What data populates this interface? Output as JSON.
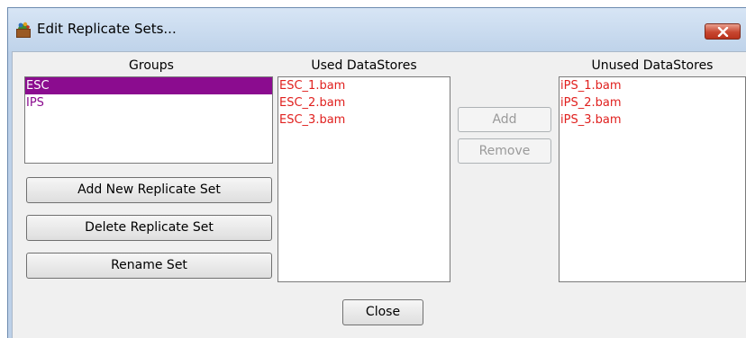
{
  "window": {
    "title": "Edit Replicate Sets...",
    "close_icon": "close-x-icon",
    "accent_close": "#c84730"
  },
  "groups": {
    "label": "Groups",
    "items": [
      {
        "label": "ESC",
        "selected": true
      },
      {
        "label": "IPS",
        "selected": false
      }
    ],
    "selected_color": "#8b0c8f"
  },
  "used": {
    "label": "Used DataStores",
    "items": [
      "ESC_1.bam",
      "ESC_2.bam",
      "ESC_3.bam"
    ],
    "text_color": "#e0201e"
  },
  "unused": {
    "label": "Unused DataStores",
    "items": [
      "iPS_1.bam",
      "iPS_2.bam",
      "iPS_3.bam"
    ]
  },
  "buttons": {
    "add_new": "Add New Replicate Set",
    "delete": "Delete Replicate Set",
    "rename": "Rename Set",
    "add": "Add",
    "remove": "Remove",
    "close": "Close"
  }
}
